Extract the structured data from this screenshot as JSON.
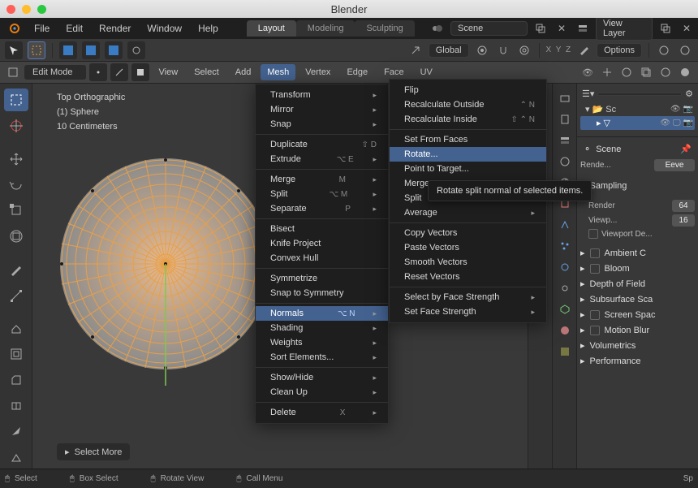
{
  "window": {
    "title": "Blender"
  },
  "menubar": {
    "file": "File",
    "edit": "Edit",
    "render": "Render",
    "window": "Window",
    "help": "Help"
  },
  "workspace_tabs": {
    "layout": "Layout",
    "modeling": "Modeling",
    "sculpting": "Sculpting"
  },
  "header_right": {
    "scene": "Scene",
    "view_layer": "View Layer"
  },
  "toolbar2": {
    "orientation": "Global",
    "options": "Options"
  },
  "toolbar3": {
    "mode": "Edit Mode",
    "view": "View",
    "select": "Select",
    "add": "Add",
    "mesh": "Mesh",
    "vertex": "Vertex",
    "edge": "Edge",
    "face": "Face",
    "uv": "UV"
  },
  "viewport": {
    "line1": "Top Orthographic",
    "line2": "(1) Sphere",
    "line3": "10 Centimeters",
    "select_more": "Select More"
  },
  "mesh_menu": {
    "transform": "Transform",
    "mirror": "Mirror",
    "snap": "Snap",
    "duplicate": "Duplicate",
    "extrude": "Extrude",
    "merge": "Merge",
    "split": "Split",
    "separate": "Separate",
    "bisect": "Bisect",
    "knife_project": "Knife Project",
    "convex_hull": "Convex Hull",
    "symmetrize": "Symmetrize",
    "snap_symmetry": "Snap to Symmetry",
    "normals": "Normals",
    "shading": "Shading",
    "weights": "Weights",
    "sort": "Sort Elements...",
    "show_hide": "Show/Hide",
    "clean_up": "Clean Up",
    "delete": "Delete",
    "sc_dup": "⇧ D",
    "sc_ext": "⌥ E",
    "sc_merge": "M",
    "sc_split": "⌥ M",
    "sc_sep": "P",
    "sc_normals": "⌥ N",
    "sc_delete": "X"
  },
  "normals_submenu": {
    "flip": "Flip",
    "recalc_outside": "Recalculate Outside",
    "recalc_inside": "Recalculate Inside",
    "set_from_faces": "Set From Faces",
    "rotate": "Rotate...",
    "point_to_target": "Point to Target...",
    "merge": "Merge",
    "split": "Split",
    "average": "Average",
    "copy_vectors": "Copy Vectors",
    "paste_vectors": "Paste Vectors",
    "smooth_vectors": "Smooth Vectors",
    "reset_vectors": "Reset Vectors",
    "select_by_strength": "Select by Face Strength",
    "set_face_strength": "Set Face Strength",
    "sc_out": "⌃ N",
    "sc_in": "⇧ ⌃ N"
  },
  "tooltip": {
    "text": "Rotate split normal of selected items."
  },
  "outliner": {
    "scene_coll": "Sc"
  },
  "properties": {
    "scene": "Scene",
    "engine_label": "Rende...",
    "engine_value": "Eeve",
    "sampling": "Sampling",
    "render": "Render",
    "render_val": "64",
    "viewport": "Viewp...",
    "viewport_val": "16",
    "viewport_den": "Viewport De...",
    "ambient": "Ambient C",
    "bloom": "Bloom",
    "dof": "Depth of Field",
    "sss": "Subsurface Sca",
    "ssr": "Screen Spac",
    "motion_blur": "Motion Blur",
    "volumetrics": "Volumetrics",
    "performance": "Performance"
  },
  "footer": {
    "select": "Select",
    "box_select": "Box Select",
    "rotate_view": "Rotate View",
    "call_menu": "Call Menu"
  }
}
